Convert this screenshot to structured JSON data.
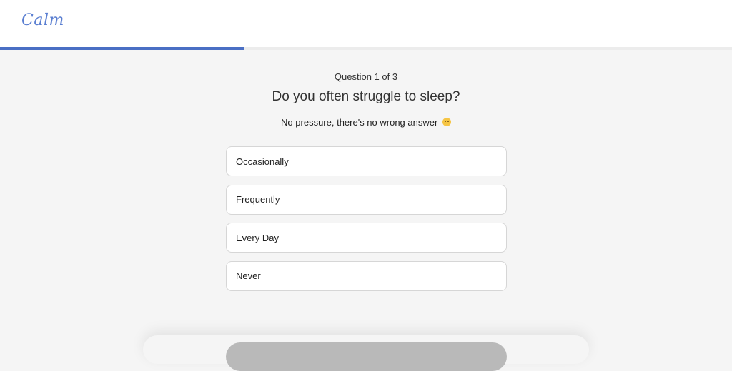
{
  "header": {
    "logo_text": "Calm"
  },
  "progress": {
    "fraction": 0.333
  },
  "quiz": {
    "counter": "Question 1 of 3",
    "question": "Do you often struggle to sleep?",
    "subtitle": "No pressure, there's no wrong answer",
    "emoji_icon": "slightly-smiling-face-icon",
    "options": [
      "Occasionally",
      "Frequently",
      "Every Day",
      "Never"
    ]
  },
  "footer": {
    "continue_label": ""
  },
  "colors": {
    "accent": "#4a6fc4",
    "logo": "#5b7fd1",
    "background": "#f5f5f5"
  }
}
